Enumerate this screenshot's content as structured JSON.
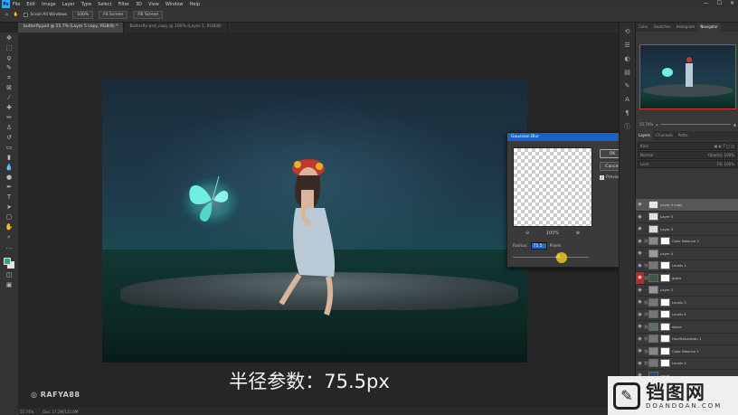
{
  "menubar": {
    "logo": "Ps",
    "items": [
      "File",
      "Edit",
      "Image",
      "Layer",
      "Type",
      "Select",
      "Filter",
      "3D",
      "View",
      "Window",
      "Help"
    ],
    "window_controls": [
      "—",
      "☐",
      "✕"
    ]
  },
  "options_bar": {
    "scroll_all_windows": "Scroll All Windows",
    "zoom": "100%",
    "fit_screen": "Fit Screen",
    "fill_screen": "Fill Screen"
  },
  "document_tabs": [
    {
      "label": "butterfly.psd @ 55.7% (Layer 5 copy, RGB/8) *",
      "active": true
    },
    {
      "label": "Butterfly-psd_copy @ 100% (Layer 1, RGB/8)",
      "active": false
    }
  ],
  "gaussian_blur": {
    "title": "Gaussian Blur",
    "ok": "OK",
    "cancel": "Cancel",
    "preview_label": "Preview",
    "zoom": "100%",
    "radius_label": "Radius:",
    "radius_value": "75.5",
    "unit": "Pixels",
    "slider_fraction": 0.6
  },
  "subtitle": "半径参数：75.5px",
  "watermark": "RAFYA88",
  "status": {
    "zoom": "55.74%",
    "doc": "Doc: 17.2M/115.0M"
  },
  "right_panel": {
    "top_tabs": [
      "Color",
      "Swatches",
      "Histogram",
      "Navigator"
    ],
    "nav_zoom": "55.74%",
    "layer_tabs": [
      "Layers",
      "Channels",
      "Paths"
    ],
    "kind": "Kind",
    "blend": "Normal",
    "opacity": "Opacity: 100%",
    "lock": "Lock:",
    "fill": "Fill: 100%",
    "layers": [
      {
        "name": "Layer 5 copy",
        "selected": true,
        "thumb": "#e8e8e8",
        "mask": false,
        "eye": "normal"
      },
      {
        "name": "Layer 5",
        "selected": false,
        "thumb": "#e0e0e0",
        "mask": false,
        "eye": "normal"
      },
      {
        "name": "Layer 3",
        "selected": false,
        "thumb": "#dcdcdc",
        "mask": false,
        "eye": "normal"
      },
      {
        "name": "Color Balance 2",
        "selected": false,
        "thumb": "#888888",
        "mask": true,
        "eye": "normal"
      },
      {
        "name": "Layer 4",
        "selected": false,
        "thumb": "#999999",
        "mask": false,
        "eye": "normal"
      },
      {
        "name": "Levels 1",
        "selected": false,
        "thumb": "#777777",
        "mask": true,
        "eye": "normal"
      },
      {
        "name": "grass",
        "selected": false,
        "thumb": "#3b5a45",
        "mask": true,
        "eye": "red"
      },
      {
        "name": "Layer 2",
        "selected": false,
        "thumb": "#8a9a9f",
        "mask": false,
        "eye": "normal"
      },
      {
        "name": "Levels 3",
        "selected": false,
        "thumb": "#777777",
        "mask": true,
        "eye": "normal"
      },
      {
        "name": "Levels 4",
        "selected": false,
        "thumb": "#777777",
        "mask": true,
        "eye": "normal"
      },
      {
        "name": "stone",
        "selected": false,
        "thumb": "#5d6c70",
        "mask": true,
        "eye": "normal"
      },
      {
        "name": "Hue/Saturation 1",
        "selected": false,
        "thumb": "#777777",
        "mask": true,
        "eye": "normal"
      },
      {
        "name": "Color Balance 1",
        "selected": false,
        "thumb": "#888888",
        "mask": true,
        "eye": "normal"
      },
      {
        "name": "Levels 2",
        "selected": false,
        "thumb": "#777777",
        "mask": true,
        "eye": "normal"
      },
      {
        "name": "cloud",
        "selected": false,
        "thumb": "#2e4a66",
        "mask": false,
        "eye": "normal"
      }
    ]
  },
  "corner_watermark": {
    "cn": "铛图网",
    "en": "DOANDOAN.COM"
  },
  "colors": {
    "accent": "#1a63c6",
    "foreground_swatch": "#2eaa78",
    "background_swatch": "#e8e8e8"
  }
}
